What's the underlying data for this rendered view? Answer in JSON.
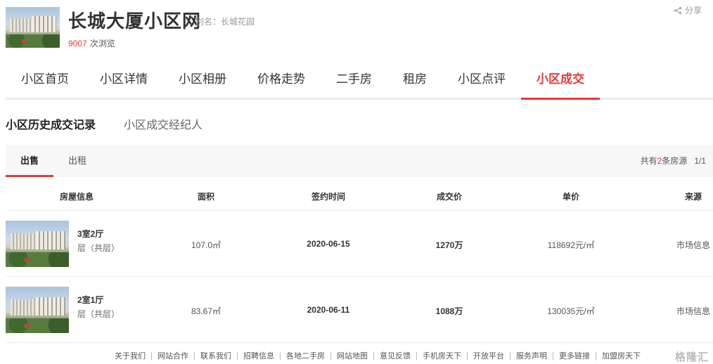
{
  "header": {
    "title": "长城大厦小区网",
    "alias": "别名：长城花园",
    "views_count": "9007",
    "views_suffix": "次浏览",
    "share_label": "分享"
  },
  "nav": {
    "items": [
      {
        "label": "小区首页"
      },
      {
        "label": "小区详情"
      },
      {
        "label": "小区相册"
      },
      {
        "label": "价格走势"
      },
      {
        "label": "二手房"
      },
      {
        "label": "租房"
      },
      {
        "label": "小区点评"
      },
      {
        "label": "小区成交"
      }
    ],
    "active": "小区成交"
  },
  "subtabs": {
    "history": "小区历史成交记录",
    "agents": "小区成交经纪人"
  },
  "listing_bar": {
    "sale": "出售",
    "rent": "出租",
    "count_prefix": "共有",
    "count_num": "2",
    "count_suffix": "条房源",
    "page": "1/1"
  },
  "table": {
    "headers": {
      "info": "房屋信息",
      "area": "面积",
      "date": "签约时间",
      "price": "成交价",
      "unit": "单价",
      "source": "来源"
    },
    "rows": [
      {
        "layout": "3室2厅",
        "floor": "层（共层）",
        "area": "107.0㎡",
        "date": "2020-06-15",
        "price": "1270万",
        "unit": "118692元/㎡",
        "source": "市场信息"
      },
      {
        "layout": "2室1厅",
        "floor": "层（共层）",
        "area": "83.67㎡",
        "date": "2020-06-11",
        "price": "1088万",
        "unit": "130035元/㎡",
        "source": "市场信息"
      }
    ]
  },
  "footer": {
    "links": [
      "关于我们",
      "网站合作",
      "联系我们",
      "招聘信息",
      "各地二手房",
      "网站地图",
      "意见反馈",
      "手机房天下",
      "开放平台",
      "服务声明",
      "更多链接",
      "加盟房天下"
    ],
    "watermark": "格隆汇"
  },
  "colors": {
    "accent": "#e4393c",
    "text": "#333333",
    "muted": "#999999"
  }
}
